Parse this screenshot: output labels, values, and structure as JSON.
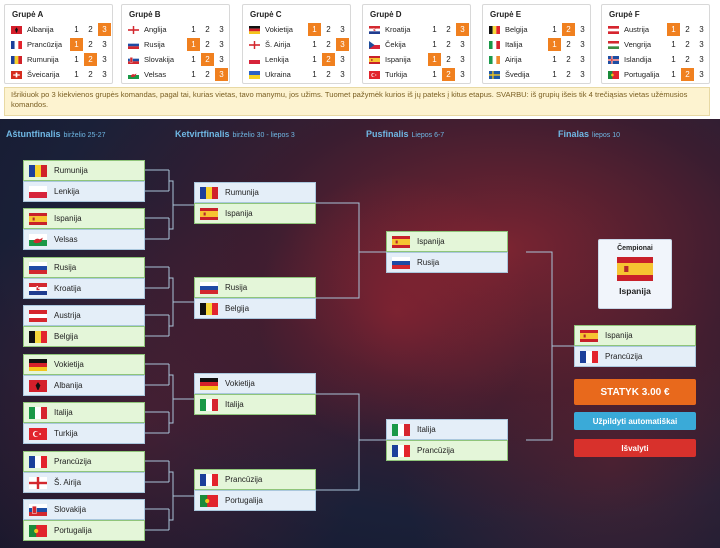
{
  "groups": [
    {
      "title": "Grupė A",
      "teams": [
        {
          "name": "Albanija",
          "flag": "AL",
          "sel": 3
        },
        {
          "name": "Prancūzija",
          "flag": "FR",
          "sel": 1
        },
        {
          "name": "Rumunija",
          "flag": "RO",
          "sel": 2
        },
        {
          "name": "Šveicarija",
          "flag": "CH",
          "sel": 0
        }
      ]
    },
    {
      "title": "Grupė B",
      "teams": [
        {
          "name": "Anglija",
          "flag": "EN",
          "sel": 0
        },
        {
          "name": "Rusija",
          "flag": "RU",
          "sel": 1
        },
        {
          "name": "Slovakija",
          "flag": "SK",
          "sel": 2
        },
        {
          "name": "Velsas",
          "flag": "WA",
          "sel": 3
        }
      ]
    },
    {
      "title": "Grupė C",
      "teams": [
        {
          "name": "Vokietija",
          "flag": "DE",
          "sel": 1
        },
        {
          "name": "Š. Airija",
          "flag": "NI",
          "sel": 3
        },
        {
          "name": "Lenkija",
          "flag": "PL",
          "sel": 2
        },
        {
          "name": "Ukraina",
          "flag": "UA",
          "sel": 0
        }
      ]
    },
    {
      "title": "Grupė D",
      "teams": [
        {
          "name": "Kroatija",
          "flag": "HR",
          "sel": 3
        },
        {
          "name": "Čekija",
          "flag": "CZ",
          "sel": 0
        },
        {
          "name": "Ispanija",
          "flag": "ES",
          "sel": 1
        },
        {
          "name": "Turkija",
          "flag": "TR",
          "sel": 2
        }
      ]
    },
    {
      "title": "Grupė E",
      "teams": [
        {
          "name": "Belgija",
          "flag": "BE",
          "sel": 2
        },
        {
          "name": "Italija",
          "flag": "IT",
          "sel": 1
        },
        {
          "name": "Airija",
          "flag": "IE",
          "sel": 0
        },
        {
          "name": "Švedija",
          "flag": "SE",
          "sel": 0
        }
      ]
    },
    {
      "title": "Grupė F",
      "teams": [
        {
          "name": "Austrija",
          "flag": "AT",
          "sel": 1
        },
        {
          "name": "Vengrija",
          "flag": "HU",
          "sel": 0
        },
        {
          "name": "Islandija",
          "flag": "IS",
          "sel": 0
        },
        {
          "name": "Portugalija",
          "flag": "PT",
          "sel": 2
        }
      ]
    }
  ],
  "info": "Išrikiuok po 3 kiekvienos grupės komandas, pagal tai, kurias vietas, tavo manymu, jos užims. Tuomet pažymėk kurios iš jų pateks į kitus etapus. SVARBU: iš grupių išeis tik 4 trečiąsias vietas užėmusios komandos.",
  "rounds": [
    {
      "title": "Aštuntfinalis",
      "dates": "birželio 25-27"
    },
    {
      "title": "Ketvirtfinalis",
      "dates": "birželio 30 - liepos 3"
    },
    {
      "title": "Pusfinalis",
      "dates": "Liepos 6-7"
    },
    {
      "title": "Finalas",
      "dates": "liepos 10"
    }
  ],
  "r16": [
    {
      "name": "Rumunija",
      "flag": "RO",
      "winner": true
    },
    {
      "name": "Lenkija",
      "flag": "PL",
      "winner": false
    },
    {
      "name": "Ispanija",
      "flag": "ES",
      "winner": true
    },
    {
      "name": "Velsas",
      "flag": "WA",
      "winner": false
    },
    {
      "name": "Rusija",
      "flag": "RU",
      "winner": true
    },
    {
      "name": "Kroatija",
      "flag": "HR",
      "winner": false
    },
    {
      "name": "Austrija",
      "flag": "AT",
      "winner": false
    },
    {
      "name": "Belgija",
      "flag": "BE",
      "winner": true
    },
    {
      "name": "Vokietija",
      "flag": "DE",
      "winner": true
    },
    {
      "name": "Albanija",
      "flag": "AL",
      "winner": false
    },
    {
      "name": "Italija",
      "flag": "IT",
      "winner": true
    },
    {
      "name": "Turkija",
      "flag": "TR",
      "winner": false
    },
    {
      "name": "Prancūzija",
      "flag": "FR",
      "winner": true
    },
    {
      "name": "Š. Airija",
      "flag": "NI",
      "winner": false
    },
    {
      "name": "Slovakija",
      "flag": "SK",
      "winner": false
    },
    {
      "name": "Portugalija",
      "flag": "PT",
      "winner": true
    }
  ],
  "qf": [
    {
      "name": "Rumunija",
      "flag": "RO",
      "winner": false
    },
    {
      "name": "Ispanija",
      "flag": "ES",
      "winner": true
    },
    {
      "name": "Rusija",
      "flag": "RU",
      "winner": true
    },
    {
      "name": "Belgija",
      "flag": "BE",
      "winner": false
    },
    {
      "name": "Vokietija",
      "flag": "DE",
      "winner": false
    },
    {
      "name": "Italija",
      "flag": "IT",
      "winner": true
    },
    {
      "name": "Prancūzija",
      "flag": "FR",
      "winner": true
    },
    {
      "name": "Portugalija",
      "flag": "PT",
      "winner": false
    }
  ],
  "sf": [
    {
      "name": "Ispanija",
      "flag": "ES",
      "winner": true
    },
    {
      "name": "Rusija",
      "flag": "RU",
      "winner": false
    },
    {
      "name": "Italija",
      "flag": "IT",
      "winner": false
    },
    {
      "name": "Prancūzija",
      "flag": "FR",
      "winner": true
    }
  ],
  "final": [
    {
      "name": "Ispanija",
      "flag": "ES",
      "winner": true
    },
    {
      "name": "Prancūzija",
      "flag": "FR",
      "winner": false
    }
  ],
  "champion": {
    "title": "Čempionai",
    "name": "Ispanija",
    "flag": "ES"
  },
  "buttons": {
    "bet": "STATYK 3.00 €",
    "auto": "Užpildyti automatiškai",
    "clear": "Išvalyti"
  }
}
